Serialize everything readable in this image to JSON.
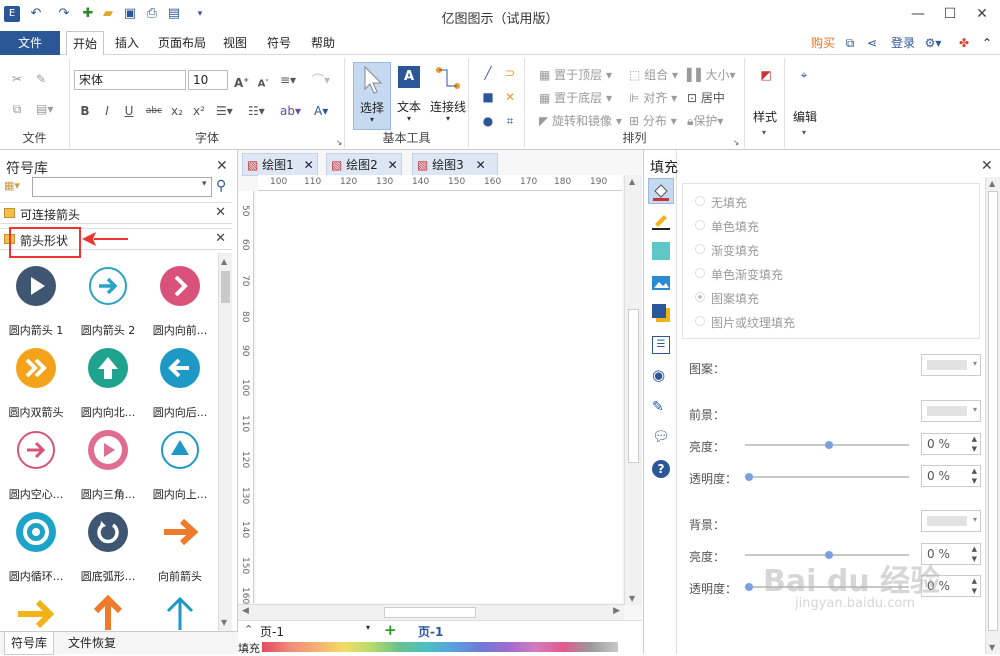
{
  "app": {
    "title": "亿图图示（试用版）"
  },
  "quickaccess": [
    "logo-icon",
    "undo-icon",
    "redo-icon",
    "new-icon",
    "open-icon",
    "save-icon",
    "print-icon",
    "export-icon",
    "more-icon"
  ],
  "menu": {
    "file": "文件",
    "tabs": [
      "开始",
      "插入",
      "页面布局",
      "视图",
      "符号",
      "帮助"
    ],
    "right": {
      "buy": "购买",
      "login": "登录"
    }
  },
  "ribbon": {
    "file_group": "文件",
    "font_group": "字体",
    "font_name": "宋体",
    "font_size": "10",
    "basic_tools_group": "基本工具",
    "select": "选择",
    "text": "文本",
    "connector": "连接线",
    "arrange_group": "排列",
    "arrange": {
      "bring_top": "置于顶层",
      "send_bottom": "置于底层",
      "rotate": "旋转和镜像",
      "group": "组合",
      "align": "对齐",
      "distribute": "分布",
      "size": "大小",
      "center": "居中",
      "protect": "保护"
    },
    "style": "样式",
    "edit": "编辑"
  },
  "library": {
    "title": "符号库",
    "categories": [
      "可连接箭头",
      "箭头形状"
    ],
    "symbols": [
      {
        "label": "圆内箭头 1",
        "color": "#3e5672",
        "glyph": "play"
      },
      {
        "label": "圆内箭头 2",
        "color": "#ffffff",
        "glyph": "arrow-right-outline"
      },
      {
        "label": "圆内向前...",
        "color": "#d9527a",
        "glyph": "chevron"
      },
      {
        "label": "圆内双箭头",
        "color": "#f4a21a",
        "glyph": "double"
      },
      {
        "label": "圆内向北...",
        "color": "#1fa38e",
        "glyph": "up"
      },
      {
        "label": "圆内向后...",
        "color": "#1e99c6",
        "glyph": "left"
      },
      {
        "label": "圆内空心...",
        "color": "#ffffff",
        "glyph": "arrow-right-pink"
      },
      {
        "label": "圆内三角...",
        "color": "#e06d8f",
        "glyph": "play-ring"
      },
      {
        "label": "圆内向上...",
        "color": "#ffffff",
        "glyph": "triangle-up"
      },
      {
        "label": "圆内循环...",
        "color": "#1ea3c8",
        "glyph": "cycle"
      },
      {
        "label": "圆底弧形...",
        "color": "#3e5672",
        "glyph": "arc"
      },
      {
        "label": "向前箭头",
        "color": "#ee7b2c",
        "glyph": "fwd"
      }
    ],
    "bottom_tabs": [
      "符号库",
      "文件恢复"
    ]
  },
  "documents": {
    "tabs": [
      "绘图1",
      "绘图2",
      "绘图3"
    ],
    "ruler_h": [
      "100",
      "110",
      "120",
      "130",
      "140",
      "150",
      "160",
      "170",
      "180",
      "190"
    ],
    "ruler_v": [
      "50",
      "60",
      "70",
      "80",
      "90",
      "100",
      "110",
      "120",
      "130",
      "140",
      "150",
      "160"
    ],
    "page_select": "页-1",
    "page_tab": "页-1",
    "color_label": "填充"
  },
  "fill_panel": {
    "title": "填充",
    "options": [
      "无填充",
      "单色填充",
      "渐变填充",
      "单色渐变填充",
      "图案填充",
      "图片或纹理填充"
    ],
    "pattern": "图案：",
    "foreground": "前景：",
    "brightness": "亮度：",
    "transparency": "透明度：",
    "background": "背景：",
    "brightness2": "亮度：",
    "transparency2": "透明度：",
    "values": {
      "fg_brightness": "0 %",
      "fg_transparency": "0 %",
      "bg_brightness": "0 %",
      "bg_transparency": "0 %"
    }
  },
  "watermark": {
    "logo": "Bai du 经验",
    "url": "jingyan.baidu.com"
  }
}
